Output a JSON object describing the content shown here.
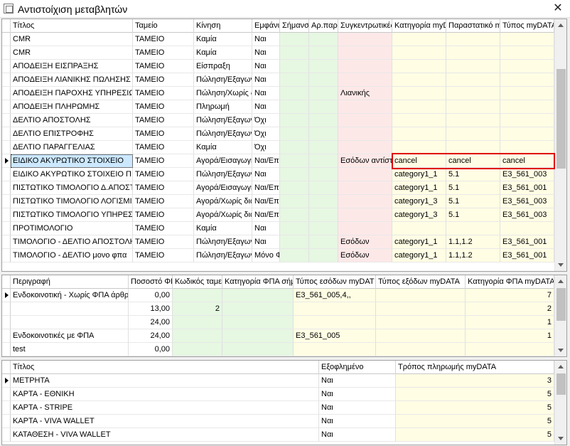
{
  "window": {
    "title": "Αντιστοίχιση μεταβλητών",
    "close_glyph": "✕"
  },
  "grid1": {
    "headers": [
      "Τίτλος",
      "Ταμείο",
      "Κίνηση",
      "Εμφάνισ",
      "Σήμανσ",
      "Αρ.παρ",
      "Συγκεντρωτικές",
      "Κατηγορία myDA",
      "Παραστατικό m",
      "Τύπος myDATA"
    ],
    "rows": [
      [
        "CMR",
        "ΤΑΜΕΙΟ",
        "Καμία",
        "Ναι",
        "",
        "",
        "",
        "",
        "",
        ""
      ],
      [
        "CMR",
        "ΤΑΜΕΙΟ",
        "Καμία",
        "Ναι",
        "",
        "",
        "",
        "",
        "",
        ""
      ],
      [
        "ΑΠΟΔΕΙΞΗ ΕΙΣΠΡΑΞΗΣ",
        "ΤΑΜΕΙΟ",
        "Είσπραξη",
        "Ναι",
        "",
        "",
        "",
        "",
        "",
        ""
      ],
      [
        "ΑΠΟΔΕΙΞΗ ΛΙΑΝΙΚΗΣ ΠΩΛΗΣΗΣ",
        "ΤΑΜΕΙΟ",
        "Πώληση/Εξαγωγή",
        "Ναι",
        "",
        "",
        "",
        "",
        "",
        ""
      ],
      [
        "ΑΠΟΔΕΙΞΗ ΠΑΡΟΧΗΣ ΥΠΗΡΕΣΙΩΝ",
        "ΤΑΜΕΙΟ",
        "Πώληση/Χωρίς δι",
        "Ναι",
        "",
        "",
        "Λιανικής",
        "",
        "",
        ""
      ],
      [
        "ΑΠΟΔΕΙΞΗ ΠΛΗΡΩΜΗΣ",
        "ΤΑΜΕΙΟ",
        "Πληρωμή",
        "Ναι",
        "",
        "",
        "",
        "",
        "",
        ""
      ],
      [
        "ΔΕΛΤΙΟ ΑΠΟΣΤΟΛΗΣ",
        "ΤΑΜΕΙΟ",
        "Πώληση/Εξαγωγή",
        "Όχι",
        "",
        "",
        "",
        "",
        "",
        ""
      ],
      [
        "ΔΕΛΤΙΟ ΕΠΙΣΤΡΟΦΗΣ",
        "ΤΑΜΕΙΟ",
        "Πώληση/Εξαγωγή",
        "Όχι",
        "",
        "",
        "",
        "",
        "",
        ""
      ],
      [
        "ΔΕΛΤΙΟ ΠΑΡΑΓΓΕΛΙΑΣ",
        "ΤΑΜΕΙΟ",
        "Καμία",
        "Όχι",
        "",
        "",
        "",
        "",
        "",
        ""
      ],
      [
        "ΕΙΔΙΚΟ ΑΚΥΡΩΤΙΚΟ ΣΤΟΙΧΕΙΟ",
        "ΤΑΜΕΙΟ",
        "Αγορά/Εισαγωγή",
        "Ναι/Επιτ",
        "",
        "",
        "Εσόδων αντίστ",
        "cancel",
        "cancel",
        "cancel"
      ],
      [
        "ΕΙΔΙΚΟ ΑΚΥΡΩΤΙΚΟ ΣΤΟΙΧΕΙΟ ΠΙΣΤ",
        "ΤΑΜΕΙΟ",
        "Πώληση/Εξαγωγή",
        "Ναι",
        "",
        "",
        "",
        "category1_1",
        "5.1",
        "E3_561_003"
      ],
      [
        "ΠΙΣΤΩΤΙΚΟ ΤΙΜΟΛΟΓΙΟ Δ.ΑΠΟΣΤΟΛ",
        "ΤΑΜΕΙΟ",
        "Αγορά/Εισαγωγή",
        "Ναι/Επιτ",
        "",
        "",
        "",
        "category1_1",
        "5.1",
        "E3_561_001"
      ],
      [
        "ΠΙΣΤΩΤΙΚΟ ΤΙΜΟΛΟΓΙΟ ΛΟΓΙΣΜΙΚΟ",
        "ΤΑΜΕΙΟ",
        "Αγορά/Χωρίς δια",
        "Ναι/Επιτ",
        "",
        "",
        "",
        "category1_3",
        "5.1",
        "E3_561_003"
      ],
      [
        "ΠΙΣΤΩΤΙΚΟ ΤΙΜΟΛΟΓΙΟ ΥΠΗΡΕΣΙΩ",
        "ΤΑΜΕΙΟ",
        "Αγορά/Χωρίς δια",
        "Ναι/Επιτ",
        "",
        "",
        "",
        "category1_3",
        "5.1",
        "E3_561_003"
      ],
      [
        "ΠΡΟΤΙΜΟΛΟΓΙΟ",
        "ΤΑΜΕΙΟ",
        "Καμία",
        "Ναι",
        "",
        "",
        "",
        "",
        "",
        ""
      ],
      [
        "ΤΙΜΟΛΟΓΙΟ - ΔΕΛΤΙΟ ΑΠΟΣΤΟΛΗΣ",
        "ΤΑΜΕΙΟ",
        "Πώληση/Εξαγωγή",
        "Ναι",
        "",
        "",
        "Εσόδων",
        "category1_1",
        "1.1,1.2",
        "E3_561_001"
      ],
      [
        "ΤΙΜΟΛΟΓΙΟ - ΔΕΛΤΙΟ μονο φπα",
        "ΤΑΜΕΙΟ",
        "Πώληση/Εξαγωγή",
        "Μόνο Φ",
        "",
        "",
        "Εσόδων",
        "category1_1",
        "1.1,1.2",
        "E3_561_001"
      ]
    ]
  },
  "grid2": {
    "headers": [
      "Περιγραφή",
      "Ποσοστό ΦΠ",
      "Κωδικός ταμε",
      "Κατηγορία ΦΠΑ σήμ",
      "Τύπος εσόδων myDAT",
      "Τύπος εξόδων myDATA",
      "Κατηγορία ΦΠΑ myDATA"
    ],
    "rows": [
      [
        "Ενδοκοινοτική - Χωρίς ΦΠΑ άρθρο",
        "0,00",
        "",
        "",
        "E3_561_005,4,,",
        "",
        "7"
      ],
      [
        "",
        "13,00",
        "2",
        "",
        "",
        "",
        "2"
      ],
      [
        "",
        "24,00",
        "",
        "",
        "",
        "",
        "1"
      ],
      [
        "Ενδοκοινοτικές με ΦΠΑ",
        "24,00",
        "",
        "",
        "E3_561_005",
        "",
        "1"
      ],
      [
        "test",
        "0,00",
        "",
        "",
        "",
        "",
        ""
      ]
    ]
  },
  "grid3": {
    "headers": [
      "Τίτλος",
      "Εξοφλημένο",
      "Τρόπος πληρωμής myDATA"
    ],
    "rows": [
      [
        "ΜΕΤΡΗΤΑ",
        "Ναι",
        "3"
      ],
      [
        "ΚΑΡΤΑ - ΕΘΝΙΚΗ",
        "Ναι",
        "5"
      ],
      [
        "ΚΑΡΤΑ - STRIPE",
        "Ναι",
        "5"
      ],
      [
        "ΚΑΡΤΑ - VIVA WALLET",
        "Ναι",
        "5"
      ],
      [
        "ΚΑΤΑΘΕΣΗ - VIVA WALLET",
        "Ναι",
        "5"
      ]
    ]
  },
  "colors": {
    "green_cell": "#e6f7e2",
    "pink_cell": "#fde8e8",
    "yellow_cell": "#fffde4",
    "selection": "#cce8ff",
    "highlight_box": "#e00000"
  }
}
